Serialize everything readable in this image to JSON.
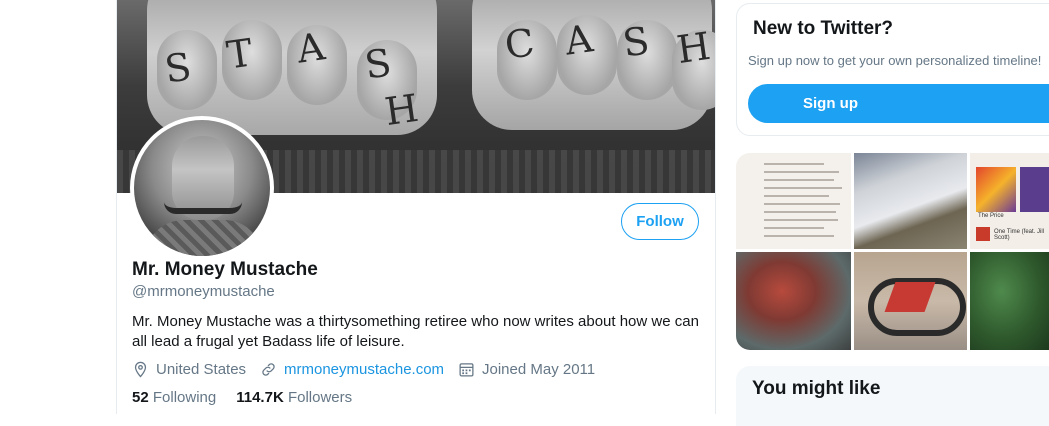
{
  "banner": {
    "letters": [
      "S",
      "T",
      "A",
      "S",
      "H",
      "C",
      "A",
      "S",
      "H"
    ]
  },
  "profile": {
    "follow_label": "Follow",
    "display_name": "Mr. Money Mustache",
    "handle": "@mrmoneymustache",
    "bio": "Mr. Money Mustache was a thirtysomething retiree who now writes about how we can all lead a frugal yet Badass life of leisure.",
    "location": "United States",
    "url": "mrmoneymustache.com",
    "joined": "Joined May 2011",
    "following_count": "52",
    "following_label": "Following",
    "followers_count": "114.7K",
    "followers_label": "Followers"
  },
  "sidebar": {
    "new_title": "New to Twitter?",
    "new_sub": "Sign up now to get your own personalized timeline!",
    "signup_label": "Sign up",
    "might_like_title": "You might like"
  },
  "media_tiles": {
    "tile3_title": "The Price",
    "tile3_track": "One Time (feat. Jill Scott)"
  },
  "colors": {
    "accent": "#1da1f2",
    "link": "#1b95e0",
    "muted": "#657786"
  },
  "icons": [
    "location-pin-icon",
    "link-icon",
    "calendar-icon"
  ]
}
